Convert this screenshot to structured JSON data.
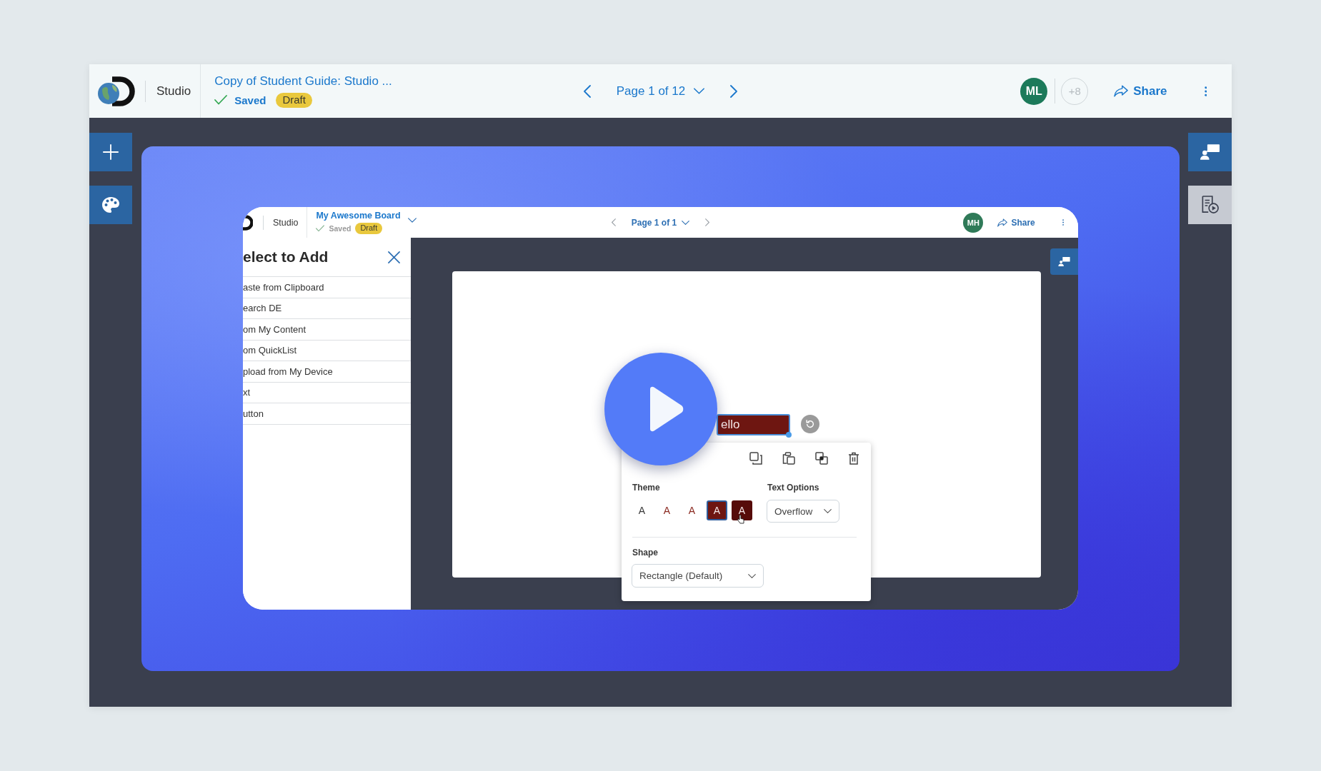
{
  "app_bar": {
    "product": "Studio",
    "doc_title": "Copy of Student Guide: Studio ...",
    "save_status": "Saved",
    "badge": "Draft",
    "page_label": "Page 1 of 12",
    "avatar": "ML",
    "more_users": "+8",
    "share_label": "Share"
  },
  "right_tools": [
    {
      "selected": true
    },
    {
      "selected": false
    }
  ],
  "video": {
    "window": {
      "product": "Studio",
      "board_title": "My Awesome Board",
      "save_status": "Saved",
      "badge": "Draft",
      "page_label": "Page 1 of 1",
      "avatar": "MH",
      "share_label": "Share"
    },
    "add_panel": {
      "title": "elect to Add",
      "items": [
        "aste from Clipboard",
        "earch DE",
        "om My Content",
        "om QuickList",
        "pload from My Device",
        "xt",
        "utton"
      ]
    },
    "canvas": {
      "text_box": "ello",
      "popup": {
        "theme_label": "Theme",
        "theme_options": [
          {
            "label": "A",
            "kind": "text",
            "color": "#3a3a3a",
            "selected": false
          },
          {
            "label": "A",
            "kind": "text",
            "color": "#8b2b22",
            "selected": false
          },
          {
            "label": "A",
            "kind": "text",
            "color": "#8b2b22",
            "selected": false
          },
          {
            "label": "A",
            "kind": "filled",
            "color": "#6e1611",
            "selected": true
          },
          {
            "label": "A",
            "kind": "filled",
            "color": "#560b09",
            "selected": false
          }
        ],
        "text_options_label": "Text Options",
        "text_options_value": "Overflow",
        "shape_label": "Shape",
        "shape_value": "Rectangle (Default)"
      }
    }
  }
}
